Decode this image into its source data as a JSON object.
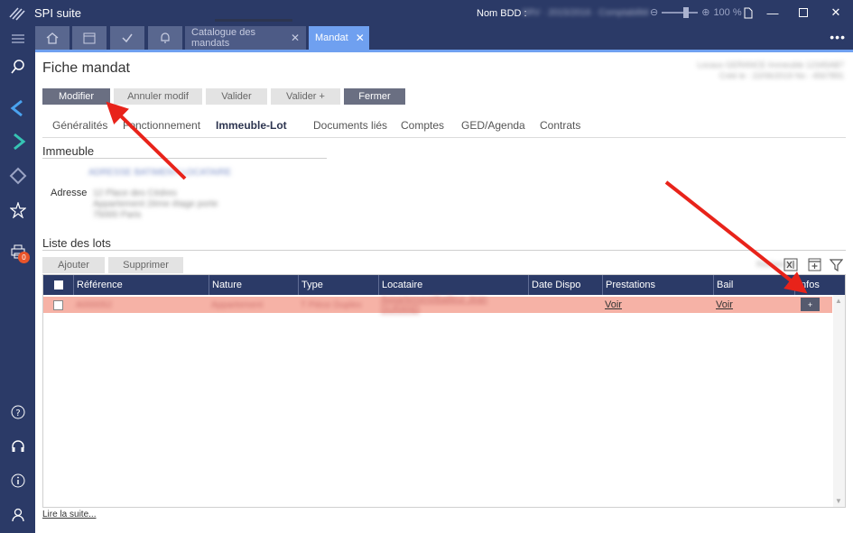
{
  "app": {
    "title": "SPI suite",
    "db_label": "Nom BDD :",
    "db_value": "SRV · 2015/2016 · Comptabilité",
    "zoom": "100 %"
  },
  "tabs": [
    {
      "label": "Catalogue des mandats"
    },
    {
      "label": "Mandat"
    }
  ],
  "page": {
    "title": "Fiche mandat",
    "info_line1": "Locaux GERANCE Immeuble 12345AB7",
    "info_line2": "Créé le : 22/06/2019 No : 4567891"
  },
  "actions": {
    "modifier": "Modifier",
    "annuler": "Annuler modif",
    "valider": "Valider",
    "valider_plus": "Valider +",
    "fermer": "Fermer"
  },
  "nav": {
    "generalites": "Généralités",
    "fonctionnement": "Fonctionnement",
    "immeuble_lot": "Immeuble-Lot",
    "documents": "Documents liés",
    "comptes": "Comptes",
    "ged": "GED/Agenda",
    "contrats": "Contrats"
  },
  "immeuble": {
    "section_title": "Immeuble",
    "name": "ADRESSE BATIMENT LOCATAIRE",
    "address_label": "Adresse",
    "address_line1": "12 Place des Cèdres",
    "address_line2": "Appartement 2ème étage porte",
    "address_line3": "75000 Paris"
  },
  "lots": {
    "section_title": "Liste des lots",
    "add_label": "Ajouter",
    "delete_label": "Supprimer",
    "search_label": "Recherche",
    "columns": {
      "reference": "Référence",
      "nature": "Nature",
      "type": "Type",
      "locataire": "Locataire",
      "date_dispo": "Date Dispo",
      "prestations": "Prestations",
      "bail": "Bail",
      "infos": "Infos"
    },
    "rows": [
      {
        "reference": "A000052",
        "nature": "Appartement",
        "type": "T Pièce Duplex",
        "locataire": "Appartement/Bailleur Jean DURAND",
        "date_dispo": "",
        "prestations": "Voir",
        "bail": "Voir",
        "infos": "+"
      }
    ]
  },
  "footer": {
    "read_more": "Lire la suite..."
  },
  "sidebar": {
    "badge_count": "0"
  },
  "colors": {
    "nav_bg": "#2b3a67",
    "accent": "#6fa0f0",
    "row_highlight": "#f6b2a6",
    "arrow": "#e8231a"
  }
}
